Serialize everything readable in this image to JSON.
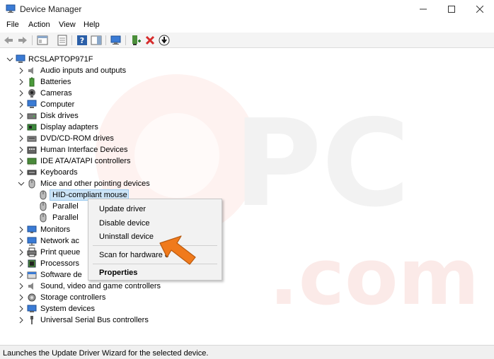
{
  "window": {
    "title": "Device Manager"
  },
  "menu": [
    "File",
    "Action",
    "View",
    "Help"
  ],
  "tree": {
    "root": "RCSLAPTOP971F",
    "categories": [
      "Audio inputs and outputs",
      "Batteries",
      "Cameras",
      "Computer",
      "Disk drives",
      "Display adapters",
      "DVD/CD-ROM drives",
      "Human Interface Devices",
      "IDE ATA/ATAPI controllers",
      "Keyboards",
      "Mice and other pointing devices",
      "Monitors",
      "Network ac",
      "Print queue",
      "Processors",
      "Software de",
      "Sound, video and game controllers",
      "Storage controllers",
      "System devices",
      "Universal Serial Bus controllers"
    ],
    "mice_children": [
      "HID-compliant mouse",
      "Parallel",
      "Parallel"
    ]
  },
  "context_menu": {
    "items": [
      "Update driver",
      "Disable device",
      "Uninstall device",
      "Scan for hardware c",
      "Properties"
    ]
  },
  "status": "Launches the Update Driver Wizard for the selected device.",
  "colors": {
    "selection": "#cce4f7",
    "arrow": "#f07a1c",
    "status_bg": "#f0f0f0"
  }
}
